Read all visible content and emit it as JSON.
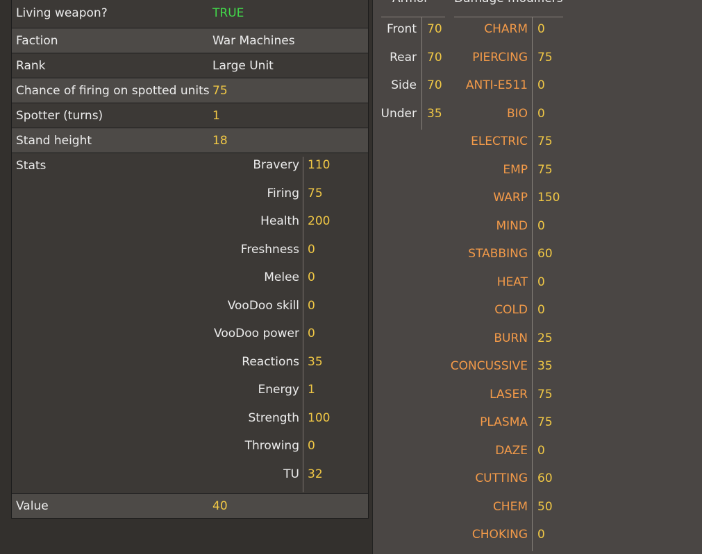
{
  "properties": [
    {
      "key": "Living weapon?",
      "value": "TRUE",
      "style": "green"
    },
    {
      "key": "Faction",
      "value": "War Machines",
      "style": "white"
    },
    {
      "key": "Rank",
      "value": "Large Unit",
      "style": "white"
    },
    {
      "key": "Chance of firing on spotted units",
      "value": "75",
      "style": "gold"
    },
    {
      "key": "Spotter (turns)",
      "value": "1",
      "style": "gold"
    },
    {
      "key": "Stand height",
      "value": "18",
      "style": "gold"
    }
  ],
  "stats": {
    "label": "Stats",
    "items": [
      {
        "name": "Bravery",
        "value": "110"
      },
      {
        "name": "Firing",
        "value": "75"
      },
      {
        "name": "Health",
        "value": "200"
      },
      {
        "name": "Freshness",
        "value": "0"
      },
      {
        "name": "Melee",
        "value": "0"
      },
      {
        "name": "VooDoo skill",
        "value": "0"
      },
      {
        "name": "VooDoo power",
        "value": "0"
      },
      {
        "name": "Reactions",
        "value": "35"
      },
      {
        "name": "Energy",
        "value": "1"
      },
      {
        "name": "Strength",
        "value": "100"
      },
      {
        "name": "Throwing",
        "value": "0"
      },
      {
        "name": "TU",
        "value": "32"
      }
    ]
  },
  "value_row": {
    "key": "Value",
    "value": "40"
  },
  "armor": {
    "header": "Armor",
    "items": [
      {
        "name": "Front",
        "value": "70"
      },
      {
        "name": "Rear",
        "value": "70"
      },
      {
        "name": "Side",
        "value": "70"
      },
      {
        "name": "Under",
        "value": "35"
      }
    ]
  },
  "damage_modifiers": {
    "header": "Damage modifiers",
    "items": [
      {
        "name": "CHARM",
        "value": "0"
      },
      {
        "name": "PIERCING",
        "value": "75"
      },
      {
        "name": "ANTI-E511",
        "value": "0"
      },
      {
        "name": "BIO",
        "value": "0"
      },
      {
        "name": "ELECTRIC",
        "value": "75"
      },
      {
        "name": "EMP",
        "value": "75"
      },
      {
        "name": "WARP",
        "value": "150"
      },
      {
        "name": "MIND",
        "value": "0"
      },
      {
        "name": "STABBING",
        "value": "60"
      },
      {
        "name": "HEAT",
        "value": "0"
      },
      {
        "name": "COLD",
        "value": "0"
      },
      {
        "name": "BURN",
        "value": "25"
      },
      {
        "name": "CONCUSSIVE",
        "value": "35"
      },
      {
        "name": "LASER",
        "value": "75"
      },
      {
        "name": "PLASMA",
        "value": "75"
      },
      {
        "name": "DAZE",
        "value": "0"
      },
      {
        "name": "CUTTING",
        "value": "60"
      },
      {
        "name": "CHEM",
        "value": "50"
      },
      {
        "name": "CHOKING",
        "value": "0"
      }
    ]
  },
  "colors": {
    "value_gold": "#f1c845",
    "true_green": "#42d84a",
    "modifier_orange": "#f39a49",
    "left_bg": "#33302d",
    "right_bg": "#4a4644"
  }
}
